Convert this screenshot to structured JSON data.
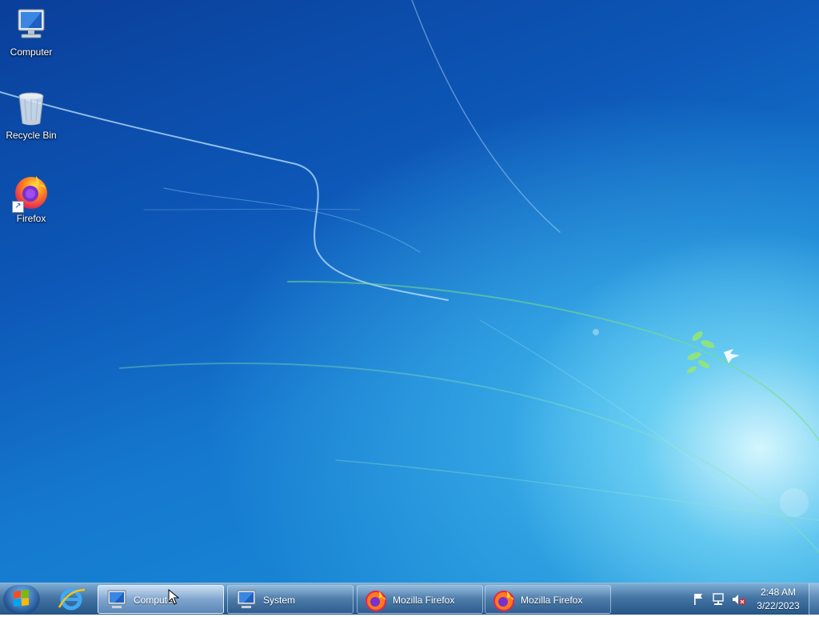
{
  "desktop": {
    "icons": [
      {
        "label": "Computer",
        "icon": "computer-icon"
      },
      {
        "label": "Recycle Bin",
        "icon": "recycle-bin-icon"
      },
      {
        "label": "Firefox",
        "icon": "firefox-icon",
        "shortcut": true
      }
    ]
  },
  "taskbar": {
    "start": {
      "icon": "windows-logo-icon"
    },
    "pinned": [
      {
        "name": "Internet Explorer",
        "icon": "internet-explorer-icon"
      }
    ],
    "buttons": [
      {
        "label": "Computer",
        "display": "Computer",
        "icon": "computer-icon",
        "active": true
      },
      {
        "label": "System",
        "display": "System",
        "icon": "computer-icon",
        "active": false
      },
      {
        "label": "Mozilla Firefox",
        "display": "Mozilla Firefox",
        "icon": "firefox-icon",
        "active": false
      },
      {
        "label": "Mozilla Firefox",
        "display": "Mozilla Firefox",
        "icon": "firefox-icon",
        "active": false
      }
    ],
    "tray": {
      "icons": [
        "action-center-flag-icon",
        "network-icon",
        "volume-muted-icon"
      ],
      "time": "2:48 AM",
      "date": "3/22/2023"
    }
  },
  "colors": {
    "wallpaper_dark": "#0a3f9a",
    "wallpaper_light": "#7fd6f2",
    "taskbar": "#3c6ea0"
  }
}
